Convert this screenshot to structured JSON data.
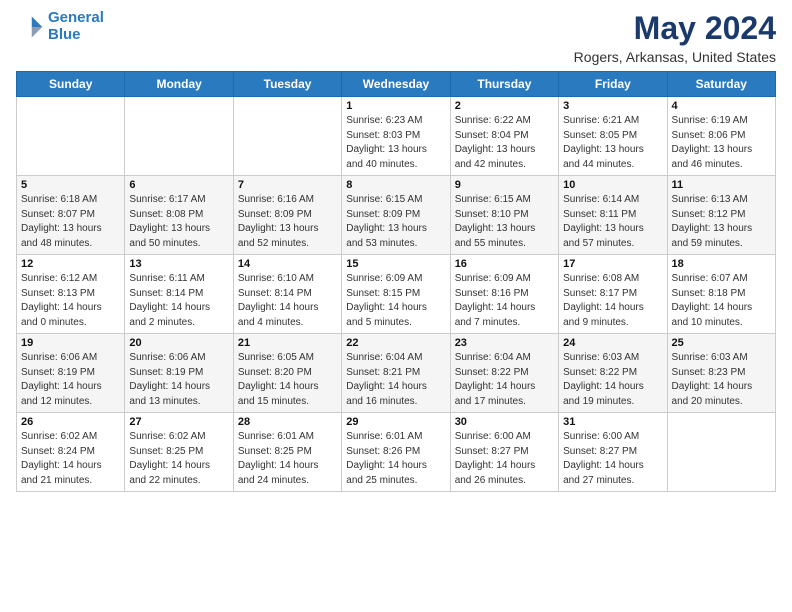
{
  "logo": {
    "line1": "General",
    "line2": "Blue"
  },
  "title": "May 2024",
  "subtitle": "Rogers, Arkansas, United States",
  "days_header": [
    "Sunday",
    "Monday",
    "Tuesday",
    "Wednesday",
    "Thursday",
    "Friday",
    "Saturday"
  ],
  "weeks": [
    [
      {
        "day": "",
        "info": ""
      },
      {
        "day": "",
        "info": ""
      },
      {
        "day": "",
        "info": ""
      },
      {
        "day": "1",
        "info": "Sunrise: 6:23 AM\nSunset: 8:03 PM\nDaylight: 13 hours\nand 40 minutes."
      },
      {
        "day": "2",
        "info": "Sunrise: 6:22 AM\nSunset: 8:04 PM\nDaylight: 13 hours\nand 42 minutes."
      },
      {
        "day": "3",
        "info": "Sunrise: 6:21 AM\nSunset: 8:05 PM\nDaylight: 13 hours\nand 44 minutes."
      },
      {
        "day": "4",
        "info": "Sunrise: 6:19 AM\nSunset: 8:06 PM\nDaylight: 13 hours\nand 46 minutes."
      }
    ],
    [
      {
        "day": "5",
        "info": "Sunrise: 6:18 AM\nSunset: 8:07 PM\nDaylight: 13 hours\nand 48 minutes."
      },
      {
        "day": "6",
        "info": "Sunrise: 6:17 AM\nSunset: 8:08 PM\nDaylight: 13 hours\nand 50 minutes."
      },
      {
        "day": "7",
        "info": "Sunrise: 6:16 AM\nSunset: 8:09 PM\nDaylight: 13 hours\nand 52 minutes."
      },
      {
        "day": "8",
        "info": "Sunrise: 6:15 AM\nSunset: 8:09 PM\nDaylight: 13 hours\nand 53 minutes."
      },
      {
        "day": "9",
        "info": "Sunrise: 6:15 AM\nSunset: 8:10 PM\nDaylight: 13 hours\nand 55 minutes."
      },
      {
        "day": "10",
        "info": "Sunrise: 6:14 AM\nSunset: 8:11 PM\nDaylight: 13 hours\nand 57 minutes."
      },
      {
        "day": "11",
        "info": "Sunrise: 6:13 AM\nSunset: 8:12 PM\nDaylight: 13 hours\nand 59 minutes."
      }
    ],
    [
      {
        "day": "12",
        "info": "Sunrise: 6:12 AM\nSunset: 8:13 PM\nDaylight: 14 hours\nand 0 minutes."
      },
      {
        "day": "13",
        "info": "Sunrise: 6:11 AM\nSunset: 8:14 PM\nDaylight: 14 hours\nand 2 minutes."
      },
      {
        "day": "14",
        "info": "Sunrise: 6:10 AM\nSunset: 8:14 PM\nDaylight: 14 hours\nand 4 minutes."
      },
      {
        "day": "15",
        "info": "Sunrise: 6:09 AM\nSunset: 8:15 PM\nDaylight: 14 hours\nand 5 minutes."
      },
      {
        "day": "16",
        "info": "Sunrise: 6:09 AM\nSunset: 8:16 PM\nDaylight: 14 hours\nand 7 minutes."
      },
      {
        "day": "17",
        "info": "Sunrise: 6:08 AM\nSunset: 8:17 PM\nDaylight: 14 hours\nand 9 minutes."
      },
      {
        "day": "18",
        "info": "Sunrise: 6:07 AM\nSunset: 8:18 PM\nDaylight: 14 hours\nand 10 minutes."
      }
    ],
    [
      {
        "day": "19",
        "info": "Sunrise: 6:06 AM\nSunset: 8:19 PM\nDaylight: 14 hours\nand 12 minutes."
      },
      {
        "day": "20",
        "info": "Sunrise: 6:06 AM\nSunset: 8:19 PM\nDaylight: 14 hours\nand 13 minutes."
      },
      {
        "day": "21",
        "info": "Sunrise: 6:05 AM\nSunset: 8:20 PM\nDaylight: 14 hours\nand 15 minutes."
      },
      {
        "day": "22",
        "info": "Sunrise: 6:04 AM\nSunset: 8:21 PM\nDaylight: 14 hours\nand 16 minutes."
      },
      {
        "day": "23",
        "info": "Sunrise: 6:04 AM\nSunset: 8:22 PM\nDaylight: 14 hours\nand 17 minutes."
      },
      {
        "day": "24",
        "info": "Sunrise: 6:03 AM\nSunset: 8:22 PM\nDaylight: 14 hours\nand 19 minutes."
      },
      {
        "day": "25",
        "info": "Sunrise: 6:03 AM\nSunset: 8:23 PM\nDaylight: 14 hours\nand 20 minutes."
      }
    ],
    [
      {
        "day": "26",
        "info": "Sunrise: 6:02 AM\nSunset: 8:24 PM\nDaylight: 14 hours\nand 21 minutes."
      },
      {
        "day": "27",
        "info": "Sunrise: 6:02 AM\nSunset: 8:25 PM\nDaylight: 14 hours\nand 22 minutes."
      },
      {
        "day": "28",
        "info": "Sunrise: 6:01 AM\nSunset: 8:25 PM\nDaylight: 14 hours\nand 24 minutes."
      },
      {
        "day": "29",
        "info": "Sunrise: 6:01 AM\nSunset: 8:26 PM\nDaylight: 14 hours\nand 25 minutes."
      },
      {
        "day": "30",
        "info": "Sunrise: 6:00 AM\nSunset: 8:27 PM\nDaylight: 14 hours\nand 26 minutes."
      },
      {
        "day": "31",
        "info": "Sunrise: 6:00 AM\nSunset: 8:27 PM\nDaylight: 14 hours\nand 27 minutes."
      },
      {
        "day": "",
        "info": ""
      }
    ]
  ]
}
